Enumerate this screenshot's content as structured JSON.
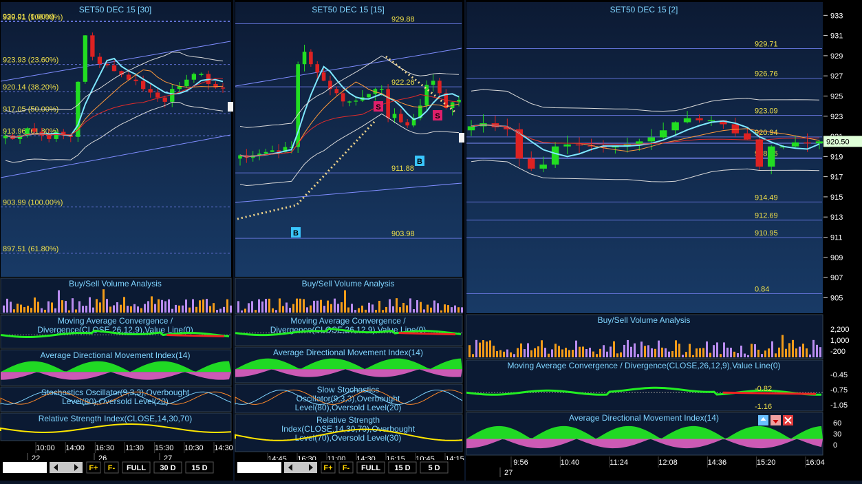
{
  "theme": {
    "bg_top": "#0c1a33",
    "bg_bottom": "#183a66",
    "sub_bg": "#0b1a33",
    "title": "#7fd4ff",
    "price_label": "#f0e04a",
    "grid": "#3b5f97",
    "candle_up": "#22dd22",
    "candle_down": "#dd2222",
    "buy": "#f39c19",
    "sell": "#b98cf0",
    "macd_pos": "#22ee22",
    "macd_neg": "#ee2222",
    "adx": "#22ee22",
    "adx_neg": "#ee66cc",
    "rsi": "#ffe600"
  },
  "panels": [
    {
      "id": "p30",
      "title": "SET50 DEC 15   [30]",
      "yrange": [
        895,
        931.5
      ],
      "fib_lines": [
        {
          "value": 930.01,
          "label": "930.01 (0.00%)"
        },
        {
          "value": 929.91,
          "label": "929.91 (100.00%)"
        },
        {
          "value": 923.93,
          "label": "923.93 (23.60%)"
        },
        {
          "value": 920.14,
          "label": "920.14 (38.20%)"
        },
        {
          "value": 917.05,
          "label": "917.05 (50.00%)"
        },
        {
          "value": 913.96,
          "label": "913.96 (61.80%)"
        },
        {
          "value": 903.99,
          "label": "903.99 (100.00%)"
        },
        {
          "value": 897.51,
          "label": "897.51 (61.80%)"
        }
      ],
      "indicators": [
        "Buy/Sell Volume Analysis",
        "Moving Average Convergence / Divergence(CLOSE,26,12,9),Value Line(0)",
        "Average Directional Movement Index(14)",
        "Stochastics Oscillator(9,3,3),Overbought Level(80),Oversold Level(20)",
        "Relative Strength Index(CLOSE,14,30,70)"
      ],
      "time_labels": [
        "10:00",
        "14:00",
        "16:30",
        "11:30",
        "15:30",
        "10:30",
        "14:30"
      ],
      "date_labels": [
        "22",
        "26",
        "27"
      ],
      "toolbar": [
        "F+",
        "F-",
        "FULL",
        "30 D",
        "15 D"
      ],
      "close": [
        914.0,
        913.5,
        914.0,
        915.0,
        914.5,
        914.0,
        913.5,
        914.5,
        914.0,
        913.8,
        921.5,
        928.0,
        925.0,
        924.0,
        923.8,
        923.0,
        922.5,
        921.8,
        921.6,
        920.5,
        920.0,
        919.3,
        918.7,
        920.5,
        920.9,
        921.8,
        922.6,
        922.6,
        921.2,
        920.7,
        920.6
      ]
    },
    {
      "id": "p15",
      "title": "SET50 DEC 15   [15]",
      "yrange": [
        900,
        931.5
      ],
      "fib_lines": [
        {
          "value": 929.88,
          "label": "929.88"
        },
        {
          "value": 922.26,
          "label": "922.26"
        },
        {
          "value": 911.88,
          "label": "911.88"
        },
        {
          "value": 903.98,
          "label": "903.98"
        }
      ],
      "markers": [
        "B",
        "S",
        "S",
        "B"
      ],
      "indicators": [
        "Buy/Sell Volume Analysis",
        "Moving Average Convergence / Divergence(CLOSE,26,12,9),Value Line(0)",
        "Average Directional Movement Index(14)",
        "Slow Stochastics Oscillator(9,3,3),Overbought Level(80),Oversold Level(20)",
        "Relative Strength Index(CLOSE,14,30,70),Overbought Level(70),Oversold Level(30)"
      ],
      "time_labels": [
        "14:45",
        "16:30",
        "11:00",
        "14:30",
        "16:15",
        "10:45",
        "14:15"
      ],
      "date_labels": [
        "26",
        "27"
      ],
      "toolbar": [
        "F+",
        "F-",
        "FULL",
        "15 D",
        "5 D"
      ],
      "close": [
        914.0,
        913.7,
        914.0,
        914.2,
        914.4,
        914.6,
        914.4,
        915.0,
        915.0,
        925.0,
        926.5,
        925.0,
        924.0,
        923.0,
        922.0,
        921.5,
        920.5,
        920.5,
        920.6,
        921.0,
        921.4,
        922.0,
        922.0,
        918.5,
        919.0,
        918.0,
        917.6,
        918.5,
        920.0,
        922.5,
        923.0,
        921.5,
        919.7,
        920.4,
        920.7
      ]
    },
    {
      "id": "p2",
      "title": "SET50 DEC 15   [2]",
      "yrange": [
        904,
        933.5
      ],
      "axis_ticks": [
        933,
        931,
        929,
        927,
        925,
        923,
        921,
        919,
        917,
        915,
        913,
        911,
        909,
        907,
        905
      ],
      "fib_lines": [
        {
          "value": 929.71,
          "label": "929.71"
        },
        {
          "value": 926.76,
          "label": "926.76"
        },
        {
          "value": 923.09,
          "label": "923.09"
        },
        {
          "value": 920.94,
          "label": "920.94"
        },
        {
          "value": 918.86,
          "label": "918.86"
        },
        {
          "value": 914.49,
          "label": "914.49"
        },
        {
          "value": 912.69,
          "label": "912.69"
        },
        {
          "value": 910.95,
          "label": "910.95"
        },
        {
          "value": 905.4,
          "label": "0.84"
        }
      ],
      "last_price": "920.50",
      "volume_ticks": [
        "2,200",
        "1,000",
        "-200"
      ],
      "macd_ticks": [
        "-0.45",
        "-0.75",
        "-1.05"
      ],
      "macd_labels": [
        "-0.82",
        "-1.16"
      ],
      "adx_ticks": [
        "60",
        "30",
        "0"
      ],
      "indicators": [
        "Buy/Sell Volume Analysis",
        "Moving Average Convergence / Divergence(CLOSE,26,12,9),Value Line(0)",
        "Average Directional Movement Index(14)"
      ],
      "time_labels": [
        "9:56",
        "10:40",
        "11:24",
        "12:08",
        "14:36",
        "15:20",
        "16:04"
      ],
      "date_labels": [
        "27"
      ],
      "close": [
        922.0,
        922.3,
        921.9,
        921.7,
        918.8,
        917.8,
        918.2,
        920.0,
        920.2,
        920.1,
        920.0,
        919.9,
        920.0,
        920.2,
        920.5,
        920.9,
        921.6,
        922.4,
        922.8,
        922.6,
        922.6,
        922.2,
        921.3,
        920.7,
        918.0,
        920.0,
        920.0,
        920.4,
        920.3,
        920.5
      ]
    }
  ]
}
